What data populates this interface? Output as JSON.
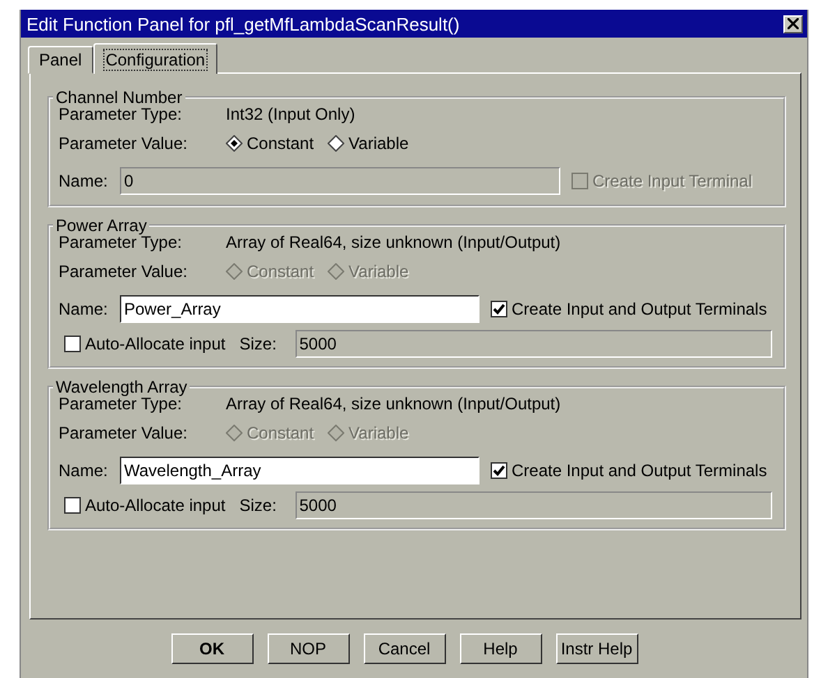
{
  "window": {
    "title": "Edit Function Panel for pfl_getMfLambdaScanResult()"
  },
  "tabs": [
    {
      "label": "Panel",
      "selected": false
    },
    {
      "label": "Configuration",
      "selected": true
    }
  ],
  "sections": [
    {
      "title": "Channel Number",
      "parameter_type_label": "Parameter Type:",
      "parameter_type": "Int32  (Input Only)",
      "parameter_value_label": "Parameter Value:",
      "options": [
        {
          "label": "Constant",
          "selected": true,
          "disabled": false
        },
        {
          "label": "Variable",
          "selected": false,
          "disabled": false
        }
      ],
      "name_label": "Name:",
      "name_value": "0",
      "name_disabled": true,
      "terminal": {
        "label": "Create Input Terminal",
        "checked": false,
        "disabled": true
      }
    },
    {
      "title": "Power Array",
      "parameter_type_label": "Parameter Type:",
      "parameter_type": "Array of Real64, size unknown  (Input/Output)",
      "parameter_value_label": "Parameter Value:",
      "options": [
        {
          "label": "Constant",
          "selected": false,
          "disabled": true
        },
        {
          "label": "Variable",
          "selected": false,
          "disabled": true
        }
      ],
      "name_label": "Name:",
      "name_value": "Power_Array",
      "name_disabled": false,
      "terminal": {
        "label": "Create Input and Output Terminals",
        "checked": true,
        "disabled": false
      },
      "auto_allocate": {
        "label": "Auto-Allocate input",
        "checked": false
      },
      "size_label": "Size:",
      "size_value": "5000"
    },
    {
      "title": "Wavelength Array",
      "parameter_type_label": "Parameter Type:",
      "parameter_type": "Array of Real64, size unknown  (Input/Output)",
      "parameter_value_label": "Parameter Value:",
      "options": [
        {
          "label": "Constant",
          "selected": false,
          "disabled": true
        },
        {
          "label": "Variable",
          "selected": false,
          "disabled": true
        }
      ],
      "name_label": "Name:",
      "name_value": "Wavelength_Array",
      "name_disabled": false,
      "terminal": {
        "label": "Create Input and Output Terminals",
        "checked": true,
        "disabled": false
      },
      "auto_allocate": {
        "label": "Auto-Allocate input",
        "checked": false
      },
      "size_label": "Size:",
      "size_value": "5000"
    }
  ],
  "buttons": [
    {
      "label": "OK",
      "default": true
    },
    {
      "label": "NOP",
      "default": false
    },
    {
      "label": "Cancel",
      "default": false
    },
    {
      "label": "Help",
      "default": false
    },
    {
      "label": "Instr Help",
      "default": false
    }
  ]
}
